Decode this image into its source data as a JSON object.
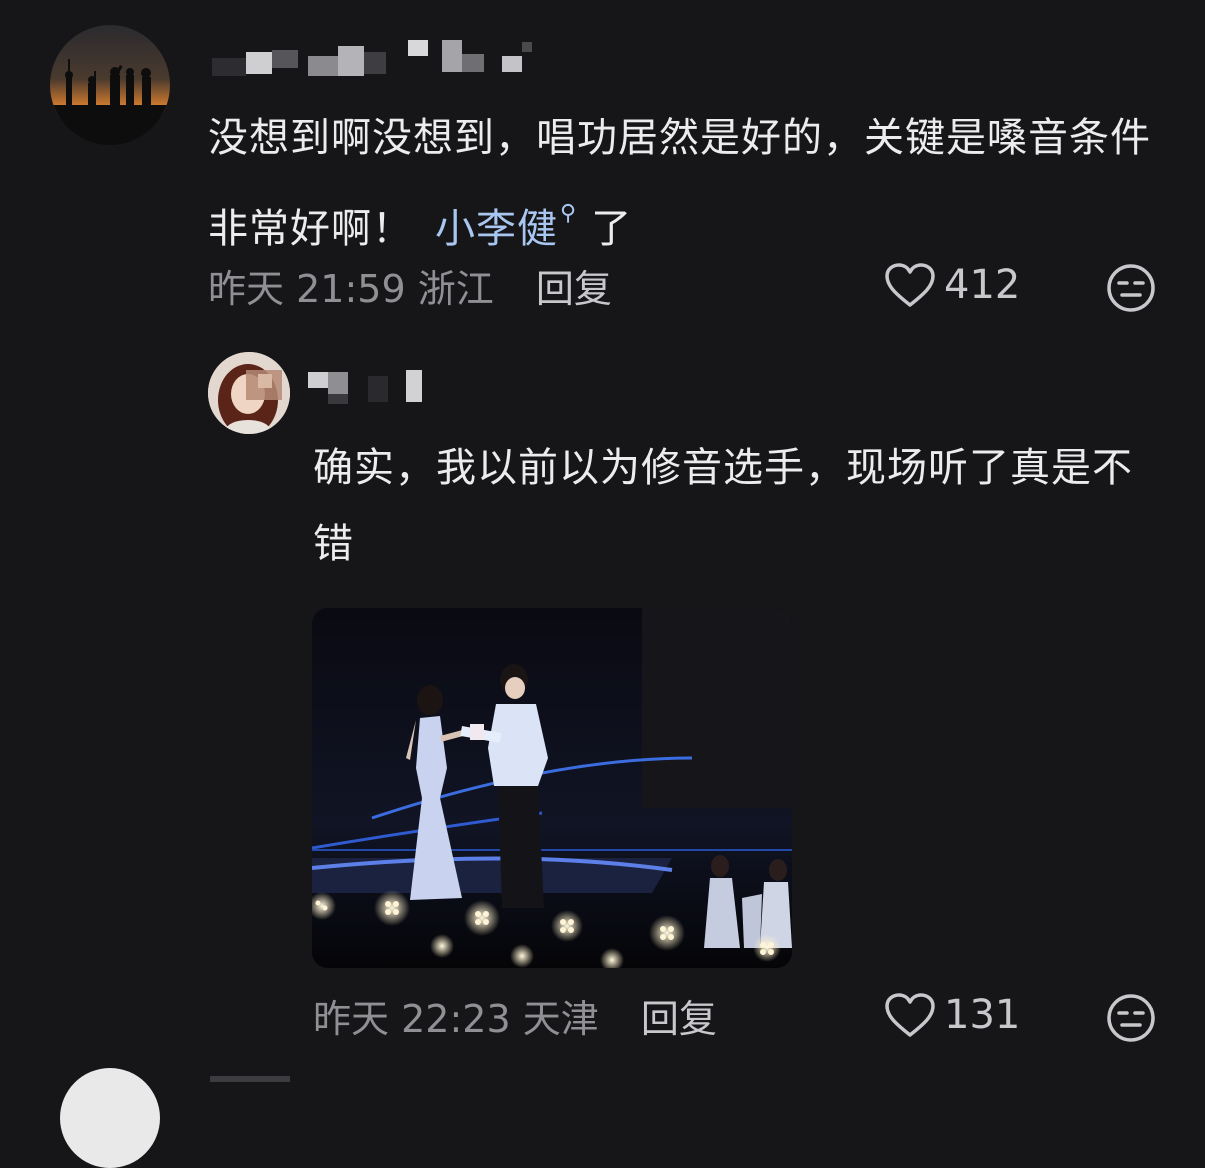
{
  "comments": [
    {
      "text_main": "没想到啊没想到，唱功居然是好的，关键是嗓音条件非常好啊！",
      "link_text": "小李健",
      "text_suffix": "了",
      "date": "昨天",
      "time": "21:59",
      "location": "浙江",
      "reply_label": "回复",
      "likes": "412",
      "username_redacted": true
    },
    {
      "text_main": "确实，我以前以为修音选手，现场听了真是不错",
      "date": "昨天",
      "time": "22:23",
      "location": "天津",
      "reply_label": "回复",
      "likes": "131",
      "username_redacted": true,
      "has_image": true
    }
  ],
  "icons": {
    "like": "heart-outline-icon",
    "reaction": "expressionless-face-icon",
    "link_search": "search-magnifier-icon"
  },
  "colors": {
    "background": "#161619",
    "text": "#ececee",
    "meta": "#8f8f94",
    "link": "#a9c6f0"
  }
}
